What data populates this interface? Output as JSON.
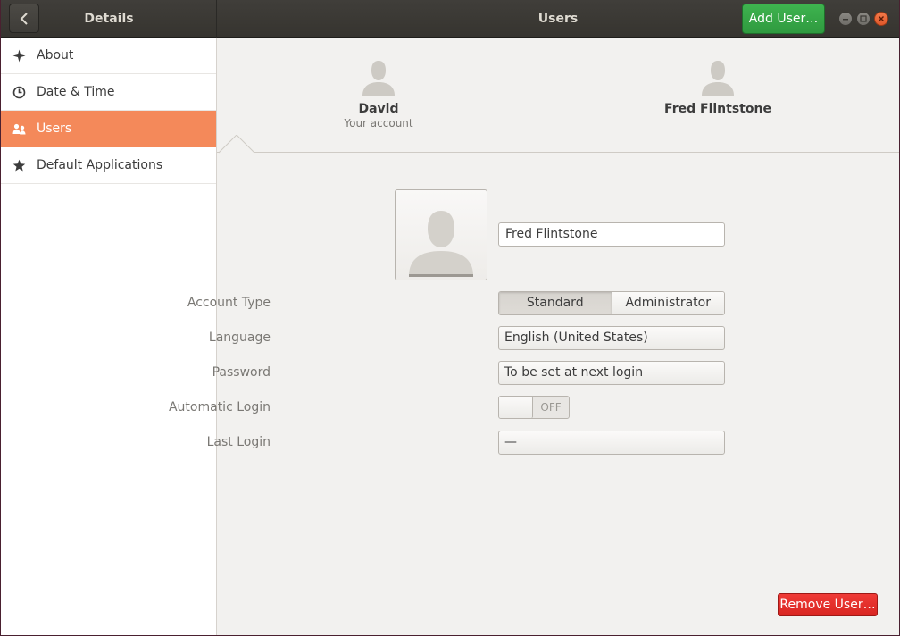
{
  "header": {
    "back_icon": "chevron-left-icon",
    "left_title": "Details",
    "main_title": "Users",
    "add_user_label": "Add User…",
    "add_user_color": "#34a845",
    "window_controls": [
      "minimize-icon",
      "maximize-icon",
      "close-icon"
    ]
  },
  "sidebar": {
    "items": [
      {
        "label": "About",
        "icon": "sparkle-icon",
        "active": false
      },
      {
        "label": "Date & Time",
        "icon": "clock-icon",
        "active": false
      },
      {
        "label": "Users",
        "icon": "users-icon",
        "active": true
      },
      {
        "label": "Default Applications",
        "icon": "star-icon",
        "active": false
      }
    ],
    "active_color": "#f4895a"
  },
  "users": [
    {
      "name": "David",
      "subtitle": "Your account",
      "selected": false
    },
    {
      "name": "Fred Flintstone",
      "subtitle": "",
      "selected": true
    }
  ],
  "detail": {
    "full_name": "Fred Flintstone",
    "account_type_label": "Account Type",
    "account_type_options": [
      "Standard",
      "Administrator"
    ],
    "account_type_selected": "Standard",
    "language_label": "Language",
    "language_value": "English (United States)",
    "password_label": "Password",
    "password_value": "To be set at next login",
    "auto_login_label": "Automatic Login",
    "auto_login_state": "OFF",
    "last_login_label": "Last Login",
    "last_login_value": "—"
  },
  "footer": {
    "remove_user_label": "Remove User…",
    "remove_color": "#e0302c"
  }
}
